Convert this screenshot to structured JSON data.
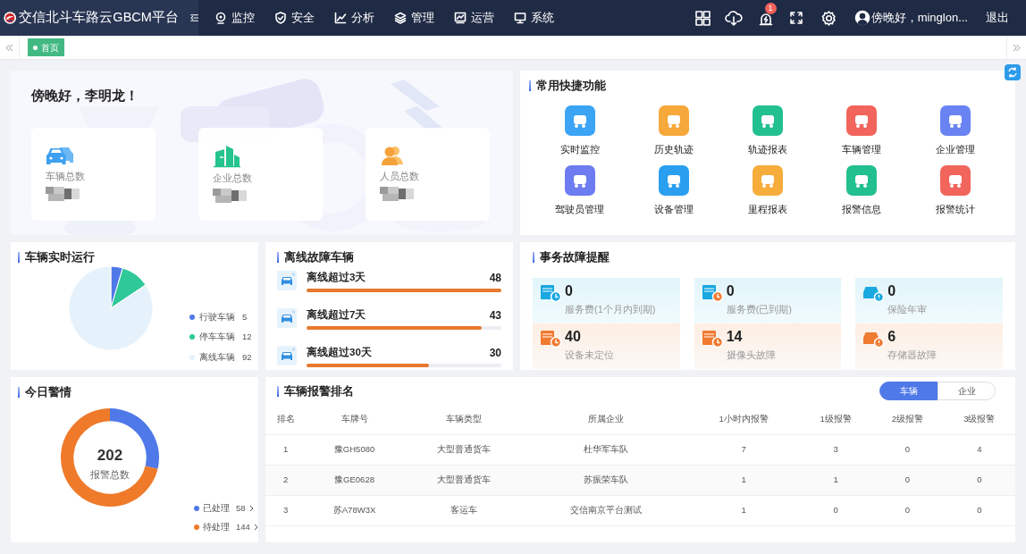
{
  "nav": {
    "title": "交信北斗车路云GBCM平台",
    "menu": [
      {
        "label": "监控"
      },
      {
        "label": "安全"
      },
      {
        "label": "分析"
      },
      {
        "label": "管理"
      },
      {
        "label": "运营"
      },
      {
        "label": "系统"
      }
    ],
    "alarm_badge": "1",
    "user": "傍晚好，minglon...",
    "logout": "退出"
  },
  "tabs": [
    {
      "label": "首页",
      "selected": true
    }
  ],
  "welcome": {
    "greeting": "傍晚好，李明龙！",
    "stats": [
      {
        "label": "车辆总数"
      },
      {
        "label": "企业总数"
      },
      {
        "label": "人员总数"
      }
    ]
  },
  "shortcuts": {
    "title": "常用快捷功能",
    "items": [
      {
        "label": "实时监控",
        "color": "#3ba4f5"
      },
      {
        "label": "历史轨迹",
        "color": "#f6a83a"
      },
      {
        "label": "轨迹报表",
        "color": "#22c08f"
      },
      {
        "label": "车辆管理",
        "color": "#f2655c"
      },
      {
        "label": "企业管理",
        "color": "#6a83f2"
      },
      {
        "label": "驾驶员管理",
        "color": "#6d7cf0"
      },
      {
        "label": "设备管理",
        "color": "#2a9ff0"
      },
      {
        "label": "里程报表",
        "color": "#f6ad3c"
      },
      {
        "label": "报警信息",
        "color": "#22c08f"
      },
      {
        "label": "报警统计",
        "color": "#f2655c"
      }
    ]
  },
  "realtime": {
    "title": "车辆实时运行",
    "chart_data": {
      "type": "pie",
      "values": [
        4.59,
        11.01,
        84.4
      ]
    },
    "legend": [
      {
        "label": "行驶车辆",
        "value": "5"
      },
      {
        "label": "停车车辆",
        "value": "12"
      },
      {
        "label": "离线车辆",
        "value": "92"
      }
    ]
  },
  "offline": {
    "title": "离线故障车辆",
    "items": [
      {
        "label": "离线超过3天",
        "value": "48",
        "level": 1
      },
      {
        "label": "离线超过7天",
        "value": "43",
        "level": 0.9
      },
      {
        "label": "离线超过30天",
        "value": "30",
        "level": 0.63
      }
    ]
  },
  "faults": {
    "title": "事务故障提醒",
    "items": [
      {
        "kind": "reminder",
        "value": "0",
        "label": "服务费(1个月内到期)"
      },
      {
        "kind": "reminder",
        "value": "0",
        "label": "服务费(已到期)"
      },
      {
        "kind": "reminder",
        "value": "0",
        "label": "保险年审"
      },
      {
        "kind": "fault",
        "value": "40",
        "label": "设备未定位"
      },
      {
        "kind": "fault",
        "value": "14",
        "label": "摄像头故障"
      },
      {
        "kind": "fault",
        "value": "6",
        "label": "存储器故障"
      }
    ]
  },
  "alarms": {
    "title": "今日警情",
    "total": "202",
    "total_label": "报警总数",
    "chart_data": {
      "type": "donut",
      "values": [
        28.71,
        71.29
      ]
    },
    "legend": [
      {
        "label": "已处理",
        "value": "58"
      },
      {
        "label": "待处理",
        "value": "144"
      }
    ]
  },
  "ranking": {
    "title": "车辆报警排名",
    "toggle": [
      {
        "label": "车辆",
        "selected": true
      },
      {
        "label": "企业",
        "selected": false
      }
    ],
    "columns": [
      "排名",
      "车牌号",
      "车辆类型",
      "所属企业",
      "1小时内报警",
      "1级报警",
      "2级报警",
      "3级报警"
    ],
    "rows": [
      [
        "1",
        "豫GH5080",
        "大型普通货车",
        "杜华军车队",
        "7",
        "3",
        "0",
        "4"
      ],
      [
        "2",
        "豫GE0628",
        "大型普通货车",
        "苏振荣车队",
        "1",
        "1",
        "0",
        "0"
      ],
      [
        "3",
        "苏A78W3X",
        "客运车",
        "交信南京平台测试",
        "1",
        "0",
        "0",
        "0"
      ]
    ]
  }
}
